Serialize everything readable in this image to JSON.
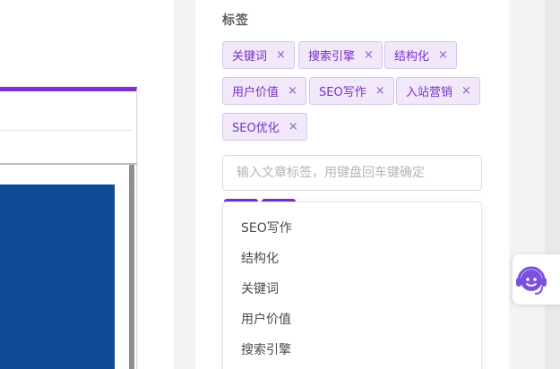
{
  "tags_section": {
    "title": "标签",
    "tags": [
      {
        "label": "关键词",
        "close": "×"
      },
      {
        "label": "搜索引擎",
        "close": "×"
      },
      {
        "label": "结构化",
        "close": "×"
      },
      {
        "label": "用户价值",
        "close": "×"
      },
      {
        "label": "SEO写作",
        "close": "×"
      },
      {
        "label": "入站营销",
        "close": "×"
      },
      {
        "label": "SEO优化",
        "close": "×"
      }
    ],
    "input_placeholder": "输入文章标签，用键盘回车键确定"
  },
  "suggestions": [
    "SEO写作",
    "结构化",
    "关键词",
    "用户价值",
    "搜索引擎"
  ],
  "support_widget": {
    "icon": "customer-service-icon"
  },
  "colors": {
    "accent": "#7a2fc9",
    "tag_bg": "#f1e8fa",
    "preview_image": "#0e4a95"
  }
}
